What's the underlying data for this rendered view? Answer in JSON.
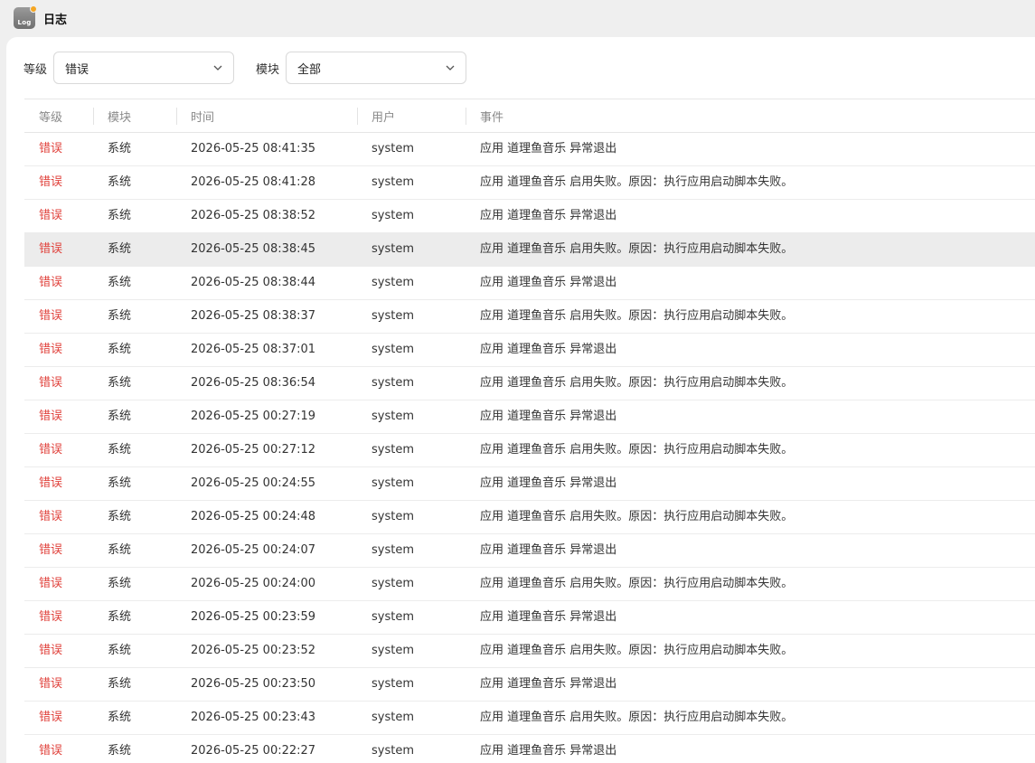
{
  "app": {
    "icon_text": "Log",
    "title": "日志"
  },
  "filters": {
    "level_label": "等级",
    "level_value": "错误",
    "module_label": "模块",
    "module_value": "全部"
  },
  "table": {
    "headers": [
      "等级",
      "模块",
      "时间",
      "用户",
      "事件"
    ],
    "rows": [
      {
        "level": "错误",
        "module": "系统",
        "time": "2026-05-25 08:41:35",
        "user": "system",
        "event": "应用 道理鱼音乐 异常退出"
      },
      {
        "level": "错误",
        "module": "系统",
        "time": "2026-05-25 08:41:28",
        "user": "system",
        "event": "应用 道理鱼音乐 启用失败。原因：执行应用启动脚本失败。"
      },
      {
        "level": "错误",
        "module": "系统",
        "time": "2026-05-25 08:38:52",
        "user": "system",
        "event": "应用 道理鱼音乐 异常退出"
      },
      {
        "level": "错误",
        "module": "系统",
        "time": "2026-05-25 08:38:45",
        "user": "system",
        "event": "应用 道理鱼音乐 启用失败。原因：执行应用启动脚本失败。",
        "highlighted": true
      },
      {
        "level": "错误",
        "module": "系统",
        "time": "2026-05-25 08:38:44",
        "user": "system",
        "event": "应用 道理鱼音乐 异常退出"
      },
      {
        "level": "错误",
        "module": "系统",
        "time": "2026-05-25 08:38:37",
        "user": "system",
        "event": "应用 道理鱼音乐 启用失败。原因：执行应用启动脚本失败。"
      },
      {
        "level": "错误",
        "module": "系统",
        "time": "2026-05-25 08:37:01",
        "user": "system",
        "event": "应用 道理鱼音乐 异常退出"
      },
      {
        "level": "错误",
        "module": "系统",
        "time": "2026-05-25 08:36:54",
        "user": "system",
        "event": "应用 道理鱼音乐 启用失败。原因：执行应用启动脚本失败。"
      },
      {
        "level": "错误",
        "module": "系统",
        "time": "2026-05-25 00:27:19",
        "user": "system",
        "event": "应用 道理鱼音乐 异常退出"
      },
      {
        "level": "错误",
        "module": "系统",
        "time": "2026-05-25 00:27:12",
        "user": "system",
        "event": "应用 道理鱼音乐 启用失败。原因：执行应用启动脚本失败。"
      },
      {
        "level": "错误",
        "module": "系统",
        "time": "2026-05-25 00:24:55",
        "user": "system",
        "event": "应用 道理鱼音乐 异常退出"
      },
      {
        "level": "错误",
        "module": "系统",
        "time": "2026-05-25 00:24:48",
        "user": "system",
        "event": "应用 道理鱼音乐 启用失败。原因：执行应用启动脚本失败。"
      },
      {
        "level": "错误",
        "module": "系统",
        "time": "2026-05-25 00:24:07",
        "user": "system",
        "event": "应用 道理鱼音乐 异常退出"
      },
      {
        "level": "错误",
        "module": "系统",
        "time": "2026-05-25 00:24:00",
        "user": "system",
        "event": "应用 道理鱼音乐 启用失败。原因：执行应用启动脚本失败。"
      },
      {
        "level": "错误",
        "module": "系统",
        "time": "2026-05-25 00:23:59",
        "user": "system",
        "event": "应用 道理鱼音乐 异常退出"
      },
      {
        "level": "错误",
        "module": "系统",
        "time": "2026-05-25 00:23:52",
        "user": "system",
        "event": "应用 道理鱼音乐 启用失败。原因：执行应用启动脚本失败。"
      },
      {
        "level": "错误",
        "module": "系统",
        "time": "2026-05-25 00:23:50",
        "user": "system",
        "event": "应用 道理鱼音乐 异常退出"
      },
      {
        "level": "错误",
        "module": "系统",
        "time": "2026-05-25 00:23:43",
        "user": "system",
        "event": "应用 道理鱼音乐 启用失败。原因：执行应用启动脚本失败。"
      },
      {
        "level": "错误",
        "module": "系统",
        "time": "2026-05-25 00:22:27",
        "user": "system",
        "event": "应用 道理鱼音乐 异常退出"
      }
    ]
  },
  "colors": {
    "error": "#e0413b",
    "highlight_row": "#ececec"
  }
}
